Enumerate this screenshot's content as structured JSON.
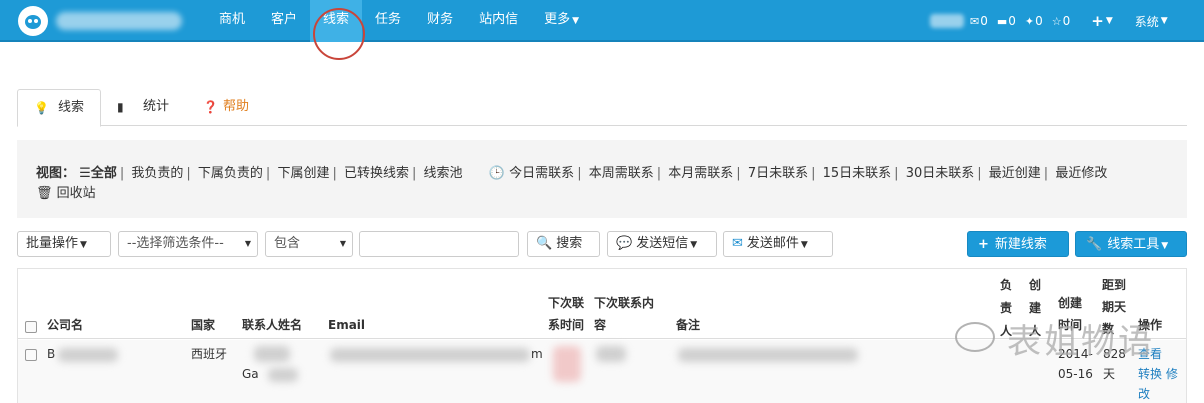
{
  "topbar": {
    "nav": [
      {
        "label": "商机"
      },
      {
        "label": "客户"
      },
      {
        "label": "线索"
      },
      {
        "label": "任务"
      },
      {
        "label": "财务"
      },
      {
        "label": "站内信"
      },
      {
        "label": "更多"
      }
    ],
    "active_index": 2,
    "counters": {
      "mail": "0",
      "doc": "0",
      "task": "0",
      "star": "0"
    },
    "system_label": "系统"
  },
  "tabs": [
    {
      "label": "线索"
    },
    {
      "label": "统计"
    },
    {
      "label": "帮助"
    }
  ],
  "view": {
    "prefix": "视图：",
    "all": "全部",
    "filters": [
      "我负责的",
      "下属负责的",
      "下属创建",
      "已转换线索",
      "线索池"
    ],
    "time_filters": [
      "今日需联系",
      "本周需联系",
      "本月需联系",
      "7日未联系",
      "15日未联系",
      "30日未联系",
      "最近创建",
      "最近修改"
    ],
    "recycle": "回收站"
  },
  "toolbar": {
    "batch": "批量操作",
    "filter_select": "--选择筛选条件--",
    "condition_select": "包含",
    "search_value": "",
    "search_btn": "搜索",
    "sms_btn": "发送短信",
    "email_btn": "发送邮件",
    "new_btn": "新建线索",
    "tools_btn": "线索工具"
  },
  "table": {
    "headers": {
      "company": "公司名",
      "country": "国家",
      "contact": "联系人姓名",
      "email": "Email",
      "next_time": "下次联系时间",
      "next_content": "下次联系内容",
      "note": "备注",
      "owner": "负责人",
      "creator": "创建人",
      "created": "创建时间",
      "days": "距到期天数",
      "ops": "操作"
    },
    "rows": [
      {
        "company": "B",
        "country": "西班牙",
        "contact": "Ga",
        "email_tail": "m",
        "created": "2014-05-16",
        "days": "828天",
        "ops": [
          "查看",
          "转换",
          "修改"
        ]
      }
    ]
  },
  "watermark": "表姐物语"
}
